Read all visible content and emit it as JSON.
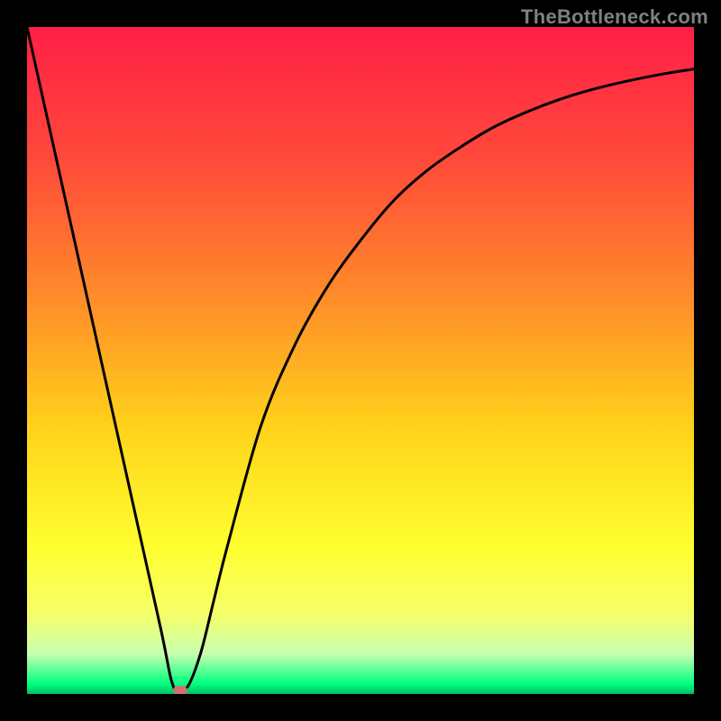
{
  "brand": "TheBottleneck.com",
  "colors": {
    "frame": "#000000",
    "curve": "#000000",
    "marker": "#d07070",
    "gradient_stops": [
      {
        "offset": 0.0,
        "color": "#ff1f46"
      },
      {
        "offset": 0.2,
        "color": "#ff4a3a"
      },
      {
        "offset": 0.4,
        "color": "#ff8a2a"
      },
      {
        "offset": 0.6,
        "color": "#ffd21a"
      },
      {
        "offset": 0.78,
        "color": "#ffff30"
      },
      {
        "offset": 0.88,
        "color": "#f6ff6a"
      },
      {
        "offset": 0.94,
        "color": "#c8ffb0"
      },
      {
        "offset": 0.985,
        "color": "#00ff7f"
      },
      {
        "offset": 1.0,
        "color": "#00c060"
      }
    ]
  },
  "chart_data": {
    "type": "line",
    "title": "",
    "xlabel": "",
    "ylabel": "",
    "xlim": [
      0,
      100
    ],
    "ylim": [
      0,
      100
    ],
    "grid": false,
    "legend": false,
    "x": [
      0,
      5,
      10,
      15,
      20,
      22,
      24,
      26,
      28,
      30,
      35,
      40,
      45,
      50,
      55,
      60,
      65,
      70,
      75,
      80,
      85,
      90,
      95,
      100
    ],
    "values": [
      100,
      77.5,
      55,
      32.5,
      10,
      1,
      1,
      6,
      14,
      22,
      40,
      52,
      61,
      68,
      74,
      78.5,
      82,
      85,
      87.3,
      89.2,
      90.7,
      91.9,
      92.9,
      93.7
    ],
    "marker": {
      "x": 23,
      "y": 0.6
    },
    "note": "Values are percentage of full scale (0 at bottom, 100 at top). Curve is a V shape with minimum near x≈23, left branch roughly linear from 100 down to ~0, right branch rises asymptotically toward ~94."
  }
}
